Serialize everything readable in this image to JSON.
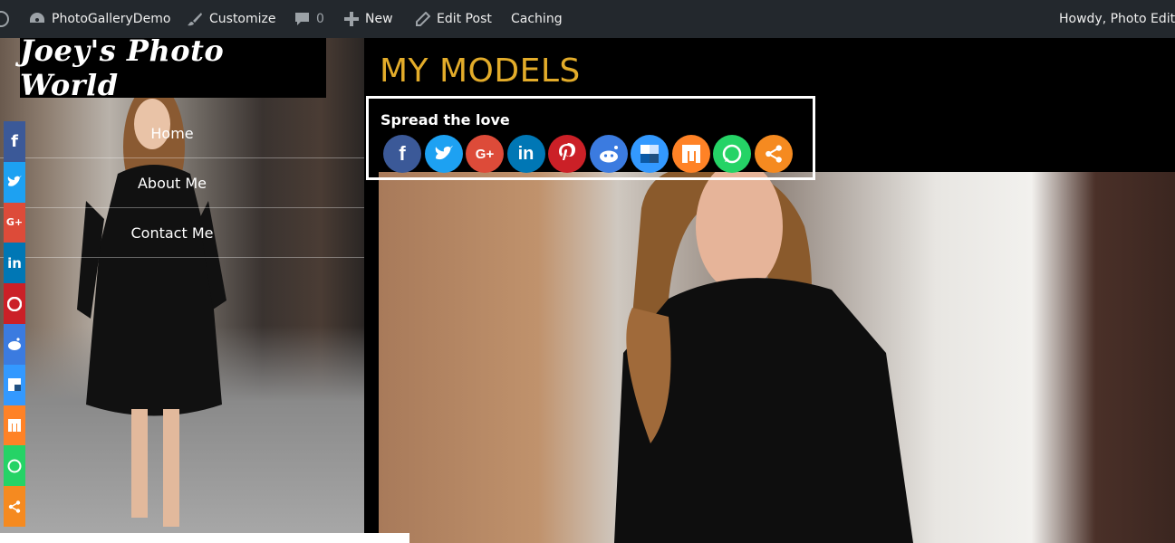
{
  "adminbar": {
    "site_name": "PhotoGalleryDemo",
    "customize": "Customize",
    "comments_count": "0",
    "new_label": "New",
    "edit_post": "Edit Post",
    "caching": "Caching",
    "howdy": "Howdy, Photo Edit"
  },
  "sidebar": {
    "logo_text": "Joey's Photo World",
    "nav": [
      "Home",
      "About Me",
      "Contact Me"
    ]
  },
  "main": {
    "page_title": "MY MODELS",
    "share_heading": "Spread the love"
  },
  "share_buttons": [
    {
      "icon": "facebook-icon",
      "color": "#3b5998",
      "glyph": "f"
    },
    {
      "icon": "twitter-icon",
      "color": "#1da1f2",
      "glyph": "t"
    },
    {
      "icon": "google-plus-icon",
      "color": "#dd4b39",
      "glyph": "G+"
    },
    {
      "icon": "linkedin-icon",
      "color": "#0077b5",
      "glyph": "in"
    },
    {
      "icon": "pinterest-icon",
      "color": "#cb2027",
      "glyph": "P"
    },
    {
      "icon": "reddit-icon",
      "color": "#3b7be0",
      "glyph": "r"
    },
    {
      "icon": "delicious-icon",
      "color": "#3399ff",
      "glyph": "d"
    },
    {
      "icon": "mix-icon",
      "color": "#ff8226",
      "glyph": "m"
    },
    {
      "icon": "whatsapp-icon",
      "color": "#25d366",
      "glyph": "w"
    },
    {
      "icon": "share-icon",
      "color": "#f58a20",
      "glyph": "<"
    }
  ]
}
